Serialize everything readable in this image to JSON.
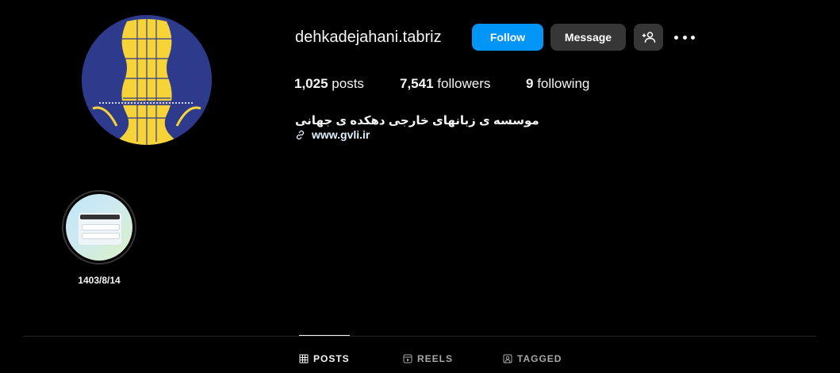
{
  "profile": {
    "username": "dehkadejahani.tabriz",
    "avatar_icon": "institute-logo-icon"
  },
  "actions": {
    "follow_label": "Follow",
    "message_label": "Message",
    "add_user_icon": "add-user-icon",
    "more_icon": "more-options-icon"
  },
  "stats": {
    "posts_count": "1,025",
    "posts_label": "posts",
    "followers_count": "7,541",
    "followers_label": "followers",
    "following_count": "9",
    "following_label": "following"
  },
  "bio": {
    "name": "موسسه ی زبانهای خارجی دهکده ی جهانی",
    "link": "www.gvli.ir",
    "link_icon": "link-icon"
  },
  "highlights": [
    {
      "label": "1403/8/14"
    }
  ],
  "tabs": [
    {
      "label": "POSTS",
      "icon": "grid-icon",
      "active": true
    },
    {
      "label": "REELS",
      "icon": "reels-icon",
      "active": false
    },
    {
      "label": "TAGGED",
      "icon": "tagged-icon",
      "active": false
    }
  ],
  "colors": {
    "background": "#000000",
    "follow_button": "#0095f6",
    "secondary_button": "#363636",
    "avatar_bg": "#2e3a8c",
    "avatar_yellow": "#f7d33a"
  }
}
